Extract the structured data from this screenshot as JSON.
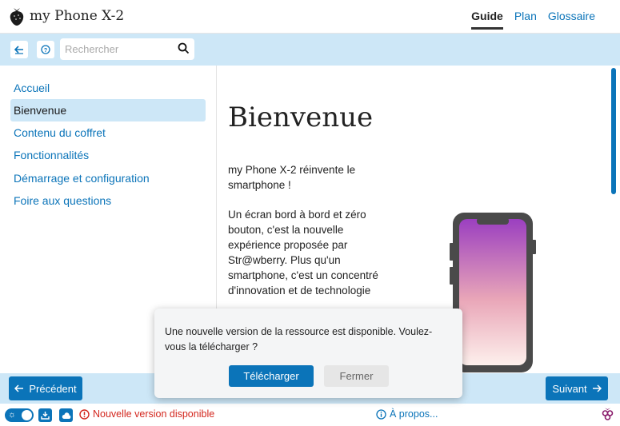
{
  "header": {
    "logo_icon": "strawberry-logo-icon",
    "app_title": "my Phone X-2",
    "nav": [
      {
        "label": "Guide",
        "active": true
      },
      {
        "label": "Plan",
        "active": false
      },
      {
        "label": "Glossaire",
        "active": false
      }
    ]
  },
  "toolbar": {
    "back_icon": "arrow-back-icon",
    "help_icon": "help-circle-icon",
    "search": {
      "placeholder": "Rechercher",
      "value": "",
      "icon": "search-icon"
    }
  },
  "sidebar": {
    "items": [
      {
        "label": "Accueil",
        "active": false
      },
      {
        "label": "Bienvenue",
        "active": true
      },
      {
        "label": "Contenu du coffret",
        "active": false
      },
      {
        "label": "Fonctionnalités",
        "active": false
      },
      {
        "label": "Démarrage et configuration",
        "active": false
      },
      {
        "label": "Foire aux questions",
        "active": false
      }
    ]
  },
  "main": {
    "title": "Bienvenue",
    "paragraphs": [
      "my Phone X-2 réinvente le smartphone !",
      "Un écran bord à bord et zéro bouton, c'est la nouvelle expérience proposée par Str@wberry. Plus qu'un smartphone, c'est un concentré d'innovation et de technologie"
    ],
    "illustration": "phone-illustration"
  },
  "footer_nav": {
    "prev": {
      "label": "Précédent",
      "icon": "arrow-left-icon"
    },
    "next": {
      "label": "Suivant",
      "icon": "arrow-right-icon"
    }
  },
  "statusbar": {
    "theme_toggle": {
      "icon": "sun-icon",
      "on": true
    },
    "download_icon": "download-icon",
    "cloud_icon": "cloud-icon",
    "alert": {
      "icon": "alert-circle-icon",
      "text": "Nouvelle version disponible"
    },
    "about": {
      "icon": "info-icon",
      "text": "À propos..."
    },
    "corner_icon": "strawberry-small-icon"
  },
  "dialog": {
    "message": "Une nouvelle version de la ressource est disponible. Voulez-vous la télécharger ?",
    "download_label": "Télécharger",
    "close_label": "Fermer"
  },
  "colors": {
    "accent": "#0b74b9",
    "toolbar_bg": "#cde7f7",
    "alert": "#d3261d",
    "phone_gradient_top": "#9b3fc0",
    "phone_gradient_bottom": "#fdf0ec"
  }
}
